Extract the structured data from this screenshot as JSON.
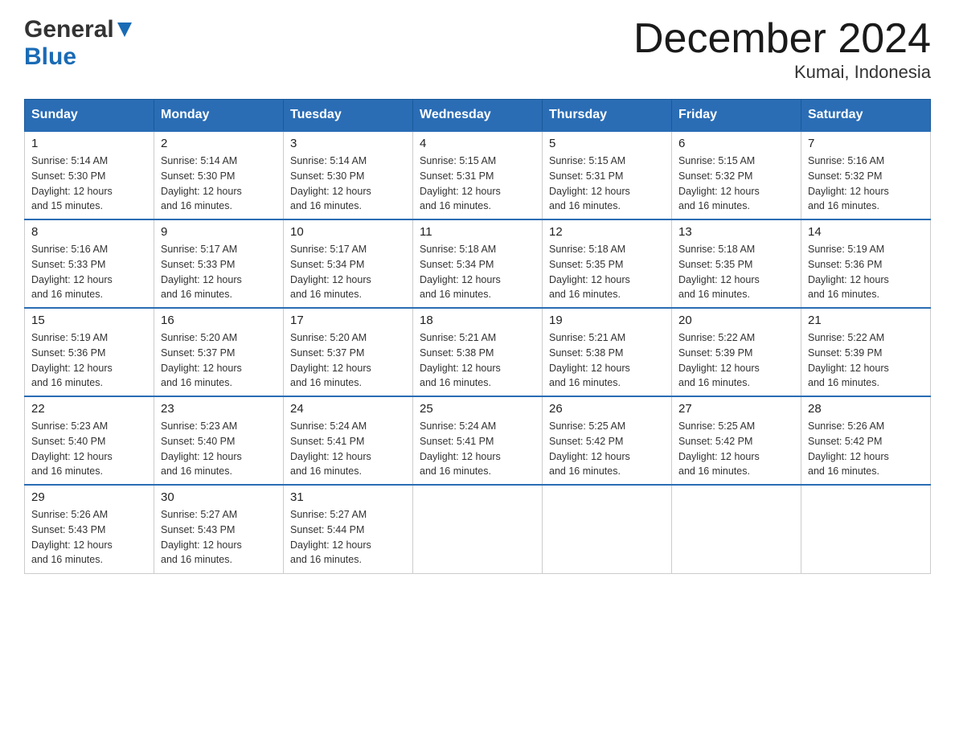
{
  "header": {
    "logo_general": "General",
    "logo_blue": "Blue",
    "month_title": "December 2024",
    "location": "Kumai, Indonesia"
  },
  "days_of_week": [
    "Sunday",
    "Monday",
    "Tuesday",
    "Wednesday",
    "Thursday",
    "Friday",
    "Saturday"
  ],
  "weeks": [
    [
      {
        "day": "1",
        "sunrise": "5:14 AM",
        "sunset": "5:30 PM",
        "daylight": "12 hours and 15 minutes."
      },
      {
        "day": "2",
        "sunrise": "5:14 AM",
        "sunset": "5:30 PM",
        "daylight": "12 hours and 16 minutes."
      },
      {
        "day": "3",
        "sunrise": "5:14 AM",
        "sunset": "5:30 PM",
        "daylight": "12 hours and 16 minutes."
      },
      {
        "day": "4",
        "sunrise": "5:15 AM",
        "sunset": "5:31 PM",
        "daylight": "12 hours and 16 minutes."
      },
      {
        "day": "5",
        "sunrise": "5:15 AM",
        "sunset": "5:31 PM",
        "daylight": "12 hours and 16 minutes."
      },
      {
        "day": "6",
        "sunrise": "5:15 AM",
        "sunset": "5:32 PM",
        "daylight": "12 hours and 16 minutes."
      },
      {
        "day": "7",
        "sunrise": "5:16 AM",
        "sunset": "5:32 PM",
        "daylight": "12 hours and 16 minutes."
      }
    ],
    [
      {
        "day": "8",
        "sunrise": "5:16 AM",
        "sunset": "5:33 PM",
        "daylight": "12 hours and 16 minutes."
      },
      {
        "day": "9",
        "sunrise": "5:17 AM",
        "sunset": "5:33 PM",
        "daylight": "12 hours and 16 minutes."
      },
      {
        "day": "10",
        "sunrise": "5:17 AM",
        "sunset": "5:34 PM",
        "daylight": "12 hours and 16 minutes."
      },
      {
        "day": "11",
        "sunrise": "5:18 AM",
        "sunset": "5:34 PM",
        "daylight": "12 hours and 16 minutes."
      },
      {
        "day": "12",
        "sunrise": "5:18 AM",
        "sunset": "5:35 PM",
        "daylight": "12 hours and 16 minutes."
      },
      {
        "day": "13",
        "sunrise": "5:18 AM",
        "sunset": "5:35 PM",
        "daylight": "12 hours and 16 minutes."
      },
      {
        "day": "14",
        "sunrise": "5:19 AM",
        "sunset": "5:36 PM",
        "daylight": "12 hours and 16 minutes."
      }
    ],
    [
      {
        "day": "15",
        "sunrise": "5:19 AM",
        "sunset": "5:36 PM",
        "daylight": "12 hours and 16 minutes."
      },
      {
        "day": "16",
        "sunrise": "5:20 AM",
        "sunset": "5:37 PM",
        "daylight": "12 hours and 16 minutes."
      },
      {
        "day": "17",
        "sunrise": "5:20 AM",
        "sunset": "5:37 PM",
        "daylight": "12 hours and 16 minutes."
      },
      {
        "day": "18",
        "sunrise": "5:21 AM",
        "sunset": "5:38 PM",
        "daylight": "12 hours and 16 minutes."
      },
      {
        "day": "19",
        "sunrise": "5:21 AM",
        "sunset": "5:38 PM",
        "daylight": "12 hours and 16 minutes."
      },
      {
        "day": "20",
        "sunrise": "5:22 AM",
        "sunset": "5:39 PM",
        "daylight": "12 hours and 16 minutes."
      },
      {
        "day": "21",
        "sunrise": "5:22 AM",
        "sunset": "5:39 PM",
        "daylight": "12 hours and 16 minutes."
      }
    ],
    [
      {
        "day": "22",
        "sunrise": "5:23 AM",
        "sunset": "5:40 PM",
        "daylight": "12 hours and 16 minutes."
      },
      {
        "day": "23",
        "sunrise": "5:23 AM",
        "sunset": "5:40 PM",
        "daylight": "12 hours and 16 minutes."
      },
      {
        "day": "24",
        "sunrise": "5:24 AM",
        "sunset": "5:41 PM",
        "daylight": "12 hours and 16 minutes."
      },
      {
        "day": "25",
        "sunrise": "5:24 AM",
        "sunset": "5:41 PM",
        "daylight": "12 hours and 16 minutes."
      },
      {
        "day": "26",
        "sunrise": "5:25 AM",
        "sunset": "5:42 PM",
        "daylight": "12 hours and 16 minutes."
      },
      {
        "day": "27",
        "sunrise": "5:25 AM",
        "sunset": "5:42 PM",
        "daylight": "12 hours and 16 minutes."
      },
      {
        "day": "28",
        "sunrise": "5:26 AM",
        "sunset": "5:42 PM",
        "daylight": "12 hours and 16 minutes."
      }
    ],
    [
      {
        "day": "29",
        "sunrise": "5:26 AM",
        "sunset": "5:43 PM",
        "daylight": "12 hours and 16 minutes."
      },
      {
        "day": "30",
        "sunrise": "5:27 AM",
        "sunset": "5:43 PM",
        "daylight": "12 hours and 16 minutes."
      },
      {
        "day": "31",
        "sunrise": "5:27 AM",
        "sunset": "5:44 PM",
        "daylight": "12 hours and 16 minutes."
      },
      null,
      null,
      null,
      null
    ]
  ],
  "labels": {
    "sunrise_prefix": "Sunrise: ",
    "sunset_prefix": "Sunset: ",
    "daylight_prefix": "Daylight: "
  }
}
